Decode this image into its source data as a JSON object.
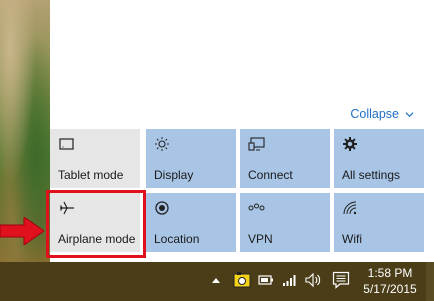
{
  "action_center": {
    "collapse_label": "Collapse",
    "tiles": [
      {
        "label": "Tablet mode",
        "icon": "tablet-icon",
        "active": false
      },
      {
        "label": "Display",
        "icon": "brightness-icon",
        "active": true
      },
      {
        "label": "Connect",
        "icon": "connect-icon",
        "active": true
      },
      {
        "label": "All settings",
        "icon": "gear-icon",
        "active": true
      },
      {
        "label": "Airplane mode",
        "icon": "airplane-icon",
        "active": false
      },
      {
        "label": "Location",
        "icon": "location-icon",
        "active": true
      },
      {
        "label": "VPN",
        "icon": "vpn-icon",
        "active": true
      },
      {
        "label": "Wifi",
        "icon": "wifi-icon",
        "active": true
      }
    ]
  },
  "taskbar": {
    "time": "1:58 PM",
    "date": "5/17/2015"
  },
  "colors": {
    "tile_active": "#a9c5e6",
    "tile_inactive": "#e6e6e6",
    "highlight": "#e0111d",
    "link": "#1f6fc5",
    "taskbar": "#4a3d18"
  }
}
